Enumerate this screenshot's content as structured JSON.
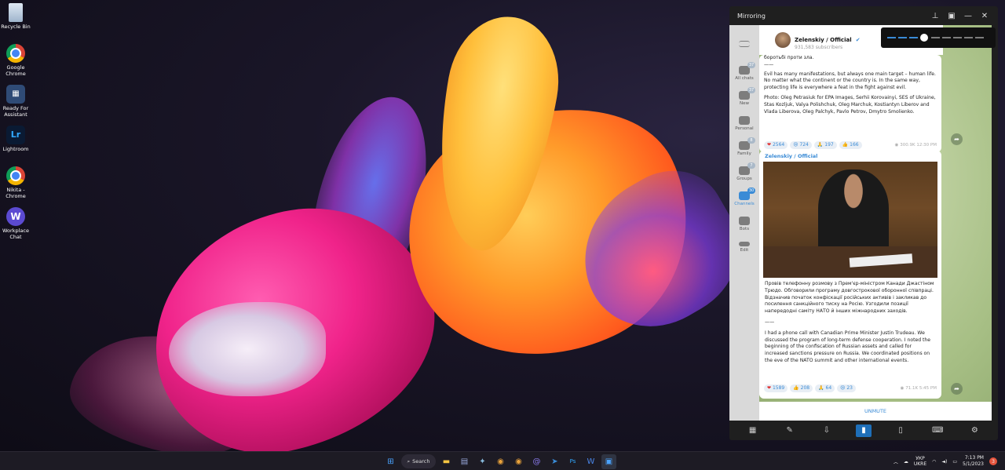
{
  "desktop": {
    "icons": [
      {
        "label": "Recycle Bin"
      },
      {
        "label": "Google Chrome"
      },
      {
        "label": "Ready For Assistant"
      },
      {
        "label": "Lightroom"
      },
      {
        "label": "Nikita - Chrome"
      },
      {
        "label": "Workplace Chat"
      }
    ]
  },
  "mirroring": {
    "title": "Mirroring",
    "window_buttons": [
      "pin",
      "restore",
      "minimize",
      "close"
    ]
  },
  "volume": {
    "level": 0.3
  },
  "telegram": {
    "sidebar": [
      {
        "label": "All chats",
        "badge": "37"
      },
      {
        "label": "New",
        "badge": "37"
      },
      {
        "label": "Personal",
        "badge": ""
      },
      {
        "label": "Family",
        "badge": "8"
      },
      {
        "label": "Groups",
        "badge": "7"
      },
      {
        "label": "Channels",
        "badge": "30"
      },
      {
        "label": "Bots",
        "badge": ""
      },
      {
        "label": "Edit",
        "badge": ""
      }
    ],
    "active_folder": "Channels",
    "channel": {
      "name": "Zelenskiy / Official",
      "subscribers": "931,583 subscribers"
    },
    "message1": {
      "lines": [
        "боротьбі проти зла.",
        "——",
        "Evil has many manifestations, but always one main target – human life. No matter what the continent or the country is. In the same way, protecting life is everywhere a feat in the fight against evil.",
        "Photo: Oleg Petrasiuk for EPA Images, Serhii Korovainyi, SES of Ukraine, Stas Kozljuk, Valya Polishchuk, Oleg Marchuk, Kostiantyn Liberov and Vlada Liberova, Oleg Palchyk, Pavlo Petrov, Dmytro Smolienko."
      ],
      "reactions": [
        {
          "emoji": "❤",
          "count": "2564"
        },
        {
          "emoji": "😢",
          "count": "724"
        },
        {
          "emoji": "🙏",
          "count": "197"
        },
        {
          "emoji": "👍",
          "count": "166"
        }
      ],
      "views": "300.9K",
      "time": "12:30 PM"
    },
    "message2": {
      "sender": "Zelenskiy / Official",
      "text_ua": "Провів телефонну розмову з Прем'єр-міністром Канади Джастіном Трюдо. Обговорили програму довгострокової оборонної співпраці. Відзначив початок конфіскації російських активів і закликав до посилення санкційного тиску на Росію. Узгодили позиції напередодні саміту НАТО й інших міжнародних заходів.",
      "separator": "——",
      "text_en": "I had a phone call with Canadian Prime Minister Justin Trudeau. We discussed the program of long-term defense cooperation. I noted the beginning of the confiscation of Russian assets and called for increased sanctions pressure on Russia. We coordinated positions on the eve of the NATO summit and other international events.",
      "reactions": [
        {
          "emoji": "❤",
          "count": "1589"
        },
        {
          "emoji": "👍",
          "count": "208"
        },
        {
          "emoji": "🙏",
          "count": "64"
        },
        {
          "emoji": "😢",
          "count": "23"
        }
      ],
      "views": "71.1K",
      "time": "5:45 PM"
    },
    "unmute_label": "UNMUTE"
  },
  "mirror_toolbar": [
    "apps-icon",
    "draw-icon",
    "download-icon",
    "screen-icon",
    "phone-icon",
    "keyboard-icon",
    "settings-icon"
  ],
  "taskbar": {
    "search_label": "Search",
    "language": "УКР",
    "language2": "UKRE",
    "time": "7:13 PM",
    "date": "5/1/2023",
    "notification_count": "3"
  }
}
